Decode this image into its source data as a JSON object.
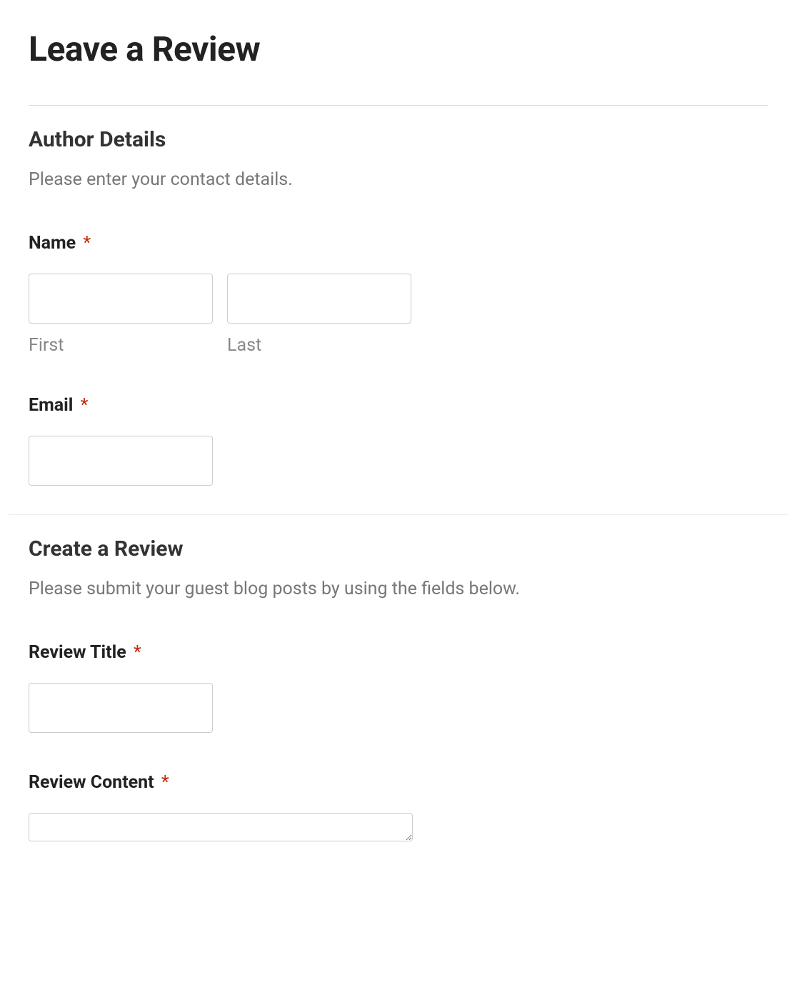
{
  "page": {
    "title": "Leave a Review"
  },
  "sections": {
    "author": {
      "heading": "Author Details",
      "description": "Please enter your contact details.",
      "fields": {
        "name": {
          "label": "Name",
          "required": "*",
          "first_sublabel": "First",
          "last_sublabel": "Last"
        },
        "email": {
          "label": "Email",
          "required": "*"
        }
      }
    },
    "review": {
      "heading": "Create a Review",
      "description": "Please submit your guest blog posts by using the fields below.",
      "fields": {
        "title": {
          "label": "Review Title",
          "required": "*"
        },
        "content": {
          "label": "Review Content",
          "required": "*"
        }
      }
    }
  }
}
